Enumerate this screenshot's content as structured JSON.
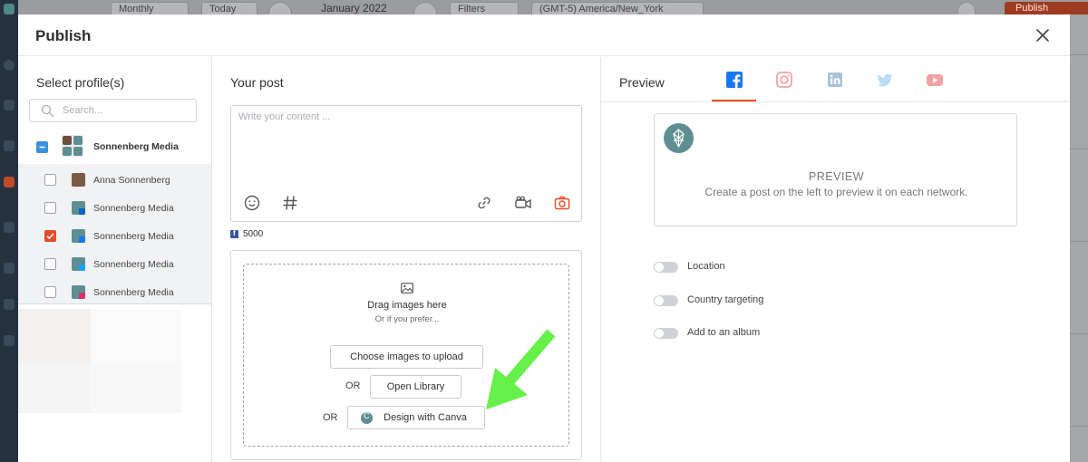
{
  "background": {
    "view_select": "Monthly",
    "today_button": "Today",
    "month_title": "January 2022",
    "filters_button": "Filters",
    "timezone_select": "(GMT-5) America/New_York",
    "publish_button": "Publish"
  },
  "modal": {
    "title": "Publish"
  },
  "profiles": {
    "title": "Select profile(s)",
    "search_placeholder": "Search...",
    "group": {
      "name": "Sonnenberg Media"
    },
    "items": [
      {
        "name": "Anna Sonnenberg",
        "network": "personal",
        "checked": false
      },
      {
        "name": "Sonnenberg Media",
        "network": "linkedin",
        "checked": false
      },
      {
        "name": "Sonnenberg Media",
        "network": "facebook",
        "checked": true
      },
      {
        "name": "Sonnenberg Media",
        "network": "twitter",
        "checked": false
      },
      {
        "name": "Sonnenberg Media",
        "network": "instagram",
        "checked": false
      }
    ]
  },
  "post": {
    "title": "Your post",
    "placeholder": "Write your content ...",
    "char_count": "5000",
    "tools": [
      "emoji-icon",
      "hashtag-icon",
      "link-icon",
      "video-icon",
      "camera-icon"
    ],
    "drop_title": "Drag images here",
    "drop_subtitle": "Or if you prefer...",
    "choose_button": "Choose images to upload",
    "or_label_1": "OR",
    "library_button": "Open Library",
    "or_label_2": "OR",
    "canva_button": "Design with Canva"
  },
  "preview": {
    "title": "Preview",
    "tabs": [
      "facebook",
      "instagram",
      "linkedin",
      "twitter",
      "youtube"
    ],
    "active_tab": "facebook",
    "heading": "PREVIEW",
    "text": "Create a post on the left to preview it on each network.",
    "toggles": [
      "Location",
      "Country targeting",
      "Add to an album"
    ]
  },
  "colors": {
    "accent": "#e84b25",
    "facebook": "#1877f2",
    "arrow": "#66f04a",
    "teal": "#5e8e91"
  }
}
